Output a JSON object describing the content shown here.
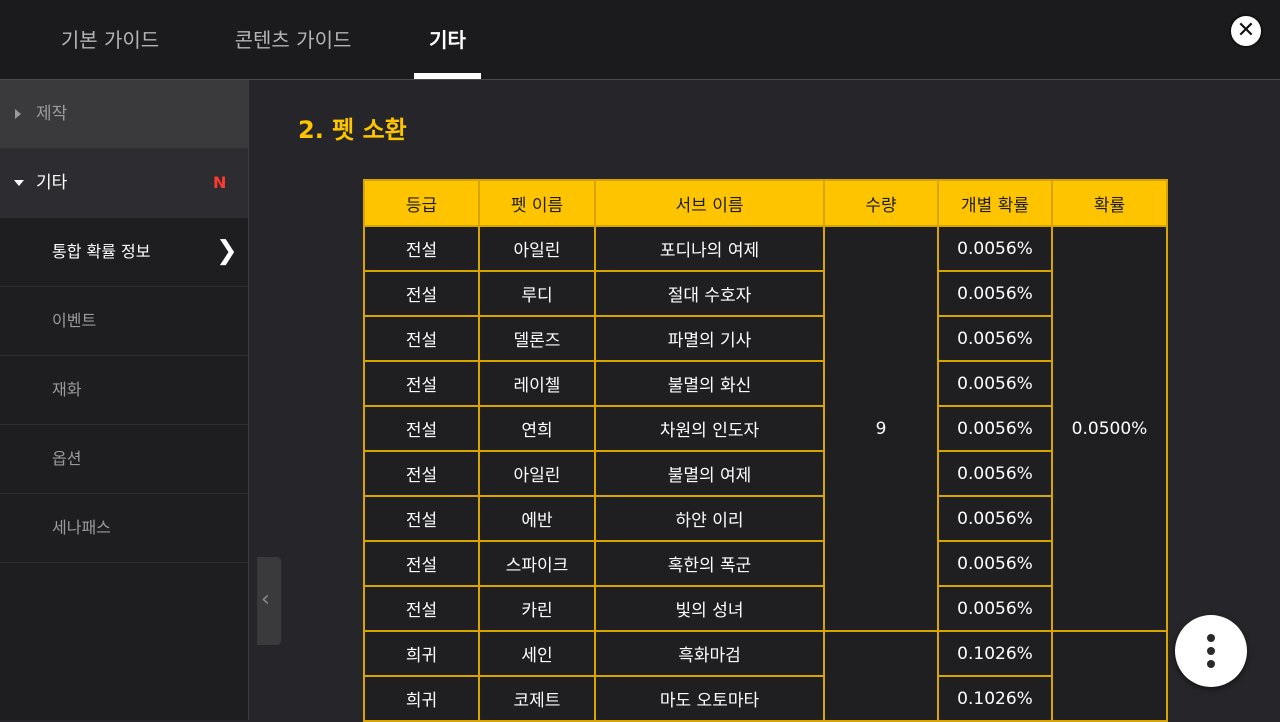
{
  "tabs": [
    {
      "label": "기본 가이드",
      "active": false
    },
    {
      "label": "콘텐츠 가이드",
      "active": false
    },
    {
      "label": "기타",
      "active": true
    }
  ],
  "close_icon": "close-icon",
  "sidebar": {
    "groups": [
      {
        "label": "제작",
        "expanded": false
      },
      {
        "label": "기타",
        "expanded": true,
        "badge": "N"
      }
    ],
    "subitems": [
      {
        "label": "통합 확률 정보",
        "active": true
      },
      {
        "label": "이벤트",
        "active": false
      },
      {
        "label": "재화",
        "active": false
      },
      {
        "label": "옵션",
        "active": false
      },
      {
        "label": "세나패스",
        "active": false
      }
    ]
  },
  "section": {
    "title": "2. 펫 소환"
  },
  "table": {
    "headers": [
      "등급",
      "펫 이름",
      "서브 이름",
      "수량",
      "개별 확률",
      "확률"
    ],
    "legend_group": {
      "count": "9",
      "total": "0.0500%"
    },
    "rows": [
      {
        "grade": "전설",
        "name": "아일린",
        "sub": "포디나의 여제",
        "prob": "0.0056%"
      },
      {
        "grade": "전설",
        "name": "루디",
        "sub": "절대 수호자",
        "prob": "0.0056%"
      },
      {
        "grade": "전설",
        "name": "델론즈",
        "sub": "파멸의 기사",
        "prob": "0.0056%"
      },
      {
        "grade": "전설",
        "name": "레이첼",
        "sub": "불멸의 화신",
        "prob": "0.0056%"
      },
      {
        "grade": "전설",
        "name": "연희",
        "sub": "차원의 인도자",
        "prob": "0.0056%"
      },
      {
        "grade": "전설",
        "name": "아일린",
        "sub": "불멸의 여제",
        "prob": "0.0056%"
      },
      {
        "grade": "전설",
        "name": "에반",
        "sub": "하얀 이리",
        "prob": "0.0056%"
      },
      {
        "grade": "전설",
        "name": "스파이크",
        "sub": "혹한의 폭군",
        "prob": "0.0056%"
      },
      {
        "grade": "전설",
        "name": "카린",
        "sub": "빛의 성녀",
        "prob": "0.0056%"
      },
      {
        "grade": "희귀",
        "name": "세인",
        "sub": "흑화마검",
        "prob": "0.1026%"
      },
      {
        "grade": "희귀",
        "name": "코제트",
        "sub": "마도 오토마타",
        "prob": "0.1026%"
      }
    ]
  },
  "icons": {
    "collapse": "chevron-left-icon",
    "menu": "more-vertical-icon",
    "subitem_arrow": "chevron-right-icon"
  },
  "colors": {
    "accent": "#ffc400",
    "badge": "#ff3b30",
    "background": "#26262a"
  }
}
